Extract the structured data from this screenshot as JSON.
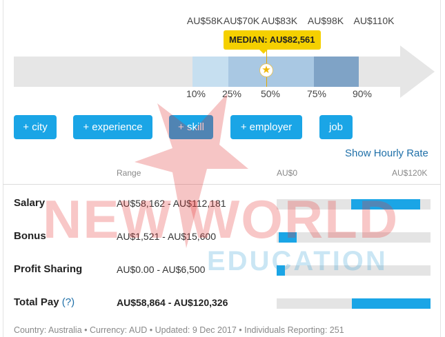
{
  "percentile_values": [
    "AU$58K",
    "AU$70K",
    "AU$83K",
    "AU$98K",
    "AU$110K"
  ],
  "percentile_labels": [
    "10%",
    "25%",
    "50%",
    "75%",
    "90%"
  ],
  "median_label": "MEDIAN: AU$82,561",
  "filter_buttons": [
    "+ city",
    "+ experience",
    "+ skill",
    "+ employer",
    "job"
  ],
  "hourly_link": "Show Hourly Rate",
  "table": {
    "range_header": "Range",
    "scale_min": "AU$0",
    "scale_max": "AU$120K",
    "rows": [
      {
        "label": "Salary",
        "range": "AU$58,162 - AU$112,181",
        "help": "",
        "min_frac": 0.485,
        "max_frac": 0.935
      },
      {
        "label": "Bonus",
        "range": "AU$1,521 - AU$15,600",
        "help": "",
        "min_frac": 0.013,
        "max_frac": 0.13
      },
      {
        "label": "Profit Sharing",
        "range": "AU$0.00 - AU$6,500",
        "help": "",
        "min_frac": 0.0,
        "max_frac": 0.054
      },
      {
        "label": "Total Pay",
        "range": "AU$58,864 - AU$120,326",
        "help": "(?)",
        "min_frac": 0.491,
        "max_frac": 1.0
      }
    ]
  },
  "footer": "Country: Australia  •  Currency: AUD  •  Updated: 9 Dec 2017  •  Individuals Reporting: 251",
  "watermark": {
    "line1": "NEW WORLD",
    "line2": "EDUCATION"
  },
  "colors": {
    "accent": "#1aa5e6",
    "median": "#f5d000",
    "link": "#1e6fa8"
  }
}
